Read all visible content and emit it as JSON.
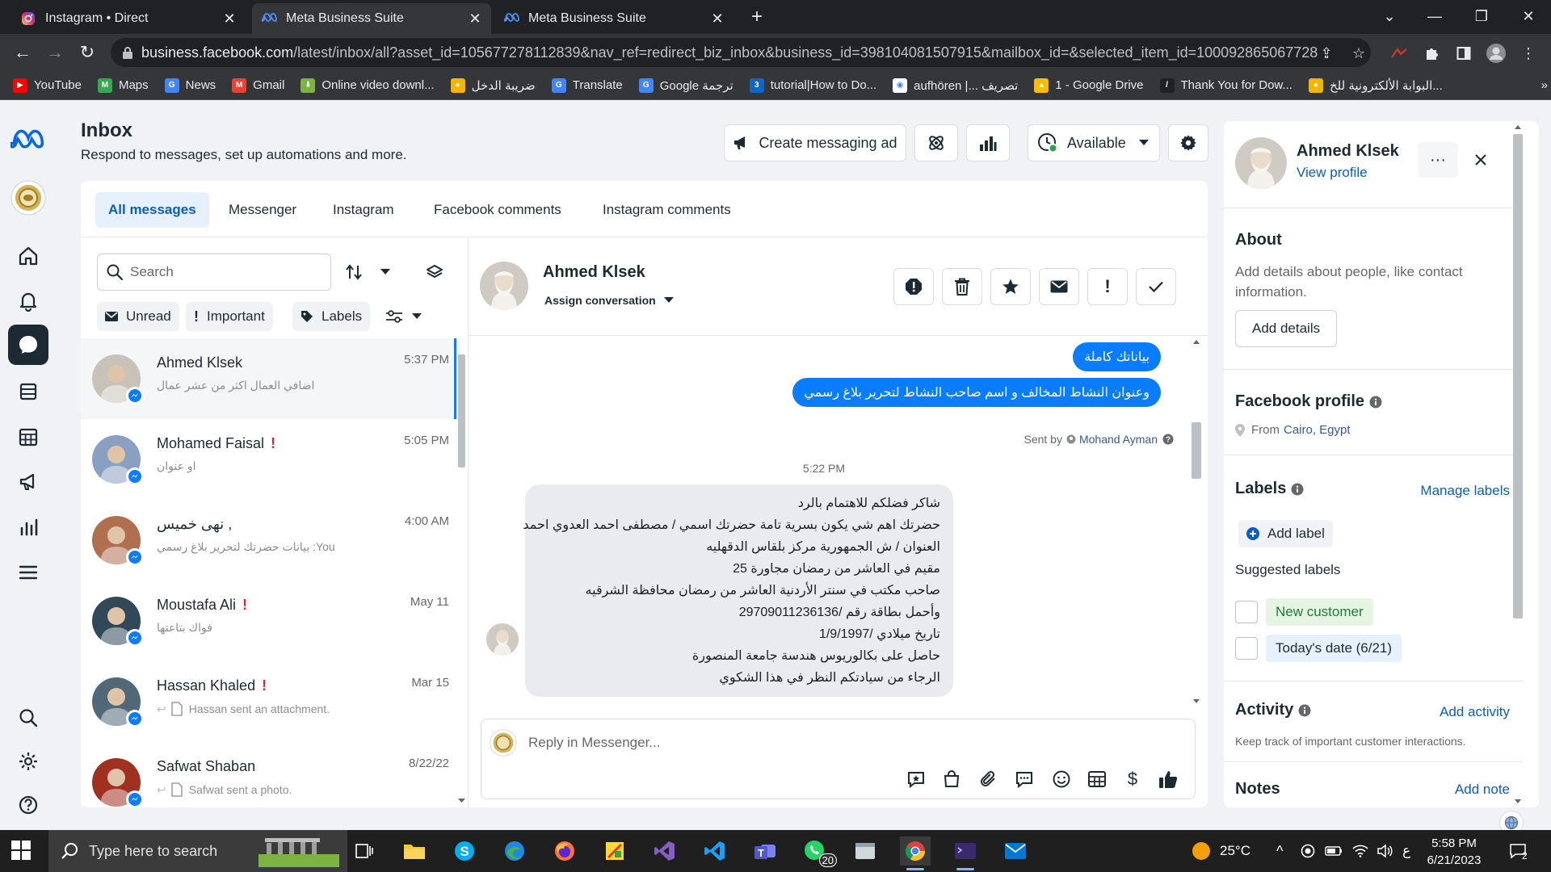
{
  "browser": {
    "tabs": [
      {
        "title": "Instagram • Direct",
        "icon": "instagram-icon",
        "active": false
      },
      {
        "title": "Meta Business Suite",
        "icon": "meta-icon",
        "active": true
      },
      {
        "title": "Meta Business Suite",
        "icon": "meta-icon",
        "active": false
      }
    ],
    "url_host": "business.facebook.com",
    "url_path": "/latest/inbox/all?asset_id=105677278112839&nav_ref=redirect_biz_inbox&business_id=398104081507915&mailbox_id=&selected_item_id=100092865067728",
    "bookmarks": [
      {
        "label": "YouTube",
        "color": "#ff0000",
        "glyph": "▶"
      },
      {
        "label": "Maps",
        "color": "#34a853",
        "glyph": "M"
      },
      {
        "label": "News",
        "color": "#4285f4",
        "glyph": "G"
      },
      {
        "label": "Gmail",
        "color": "#ea4335",
        "glyph": "M"
      },
      {
        "label": "Online video downl...",
        "color": "#7cb342",
        "glyph": "⬇"
      },
      {
        "label": "ضريبة الدخل",
        "color": "#f4b400",
        "glyph": "●"
      },
      {
        "label": "Translate",
        "color": "#4285f4",
        "glyph": "G"
      },
      {
        "label": "Google ترجمة",
        "color": "#4285f4",
        "glyph": "G"
      },
      {
        "label": "tutorial|How to Do...",
        "color": "#1565c0",
        "glyph": "3"
      },
      {
        "label": "aufhören |... تصريف",
        "color": "#ffffff",
        "glyph": "◉"
      },
      {
        "label": "1 - Google Drive",
        "color": "#fbbc04",
        "glyph": "▲"
      },
      {
        "label": "Thank You for Dow...",
        "color": "#202124",
        "glyph": "/"
      },
      {
        "label": "البوابة الألكترونية للخ...",
        "color": "#f4b400",
        "glyph": "●"
      }
    ]
  },
  "inbox": {
    "title": "Inbox",
    "subtitle": "Respond to messages, set up automations and more.",
    "create_ad": "Create messaging ad",
    "availability": "Available",
    "tabs": [
      "All messages",
      "Messenger",
      "Instagram",
      "Facebook comments",
      "Instagram comments"
    ],
    "search_placeholder": "Search",
    "filters": [
      "Unread",
      "Important",
      "Labels"
    ]
  },
  "conversations": [
    {
      "name": "Ahmed Klsek",
      "time": "5:37 PM",
      "preview": "اضافي العمال اكثر من عشر عمال",
      "important": false,
      "selected": true,
      "attachment": false,
      "avatar_color": "#c8c2b8"
    },
    {
      "name": "Mohamed Faisal",
      "time": "5:05 PM",
      "preview": "او عنوان",
      "important": true,
      "selected": false,
      "attachment": false,
      "avatar_color": "#8aa0c0"
    },
    {
      "name": "نهى خميس ,",
      "time": "4:00 AM",
      "preview": "You: بيانات حضرتك لتحرير بلاغ رسمي",
      "important": false,
      "selected": false,
      "attachment": false,
      "avatar_color": "#b07050"
    },
    {
      "name": "Moustafa Ali",
      "time": "May 11",
      "preview": "فواك بتاعتها",
      "important": true,
      "selected": false,
      "attachment": false,
      "avatar_color": "#304858"
    },
    {
      "name": "Hassan Khaled",
      "time": "Mar 15",
      "preview": "Hassan sent an attachment.",
      "important": true,
      "selected": false,
      "attachment": true,
      "avatar_color": "#506878"
    },
    {
      "name": "Safwat Shaban",
      "time": "8/22/22",
      "preview": "Safwat sent a photo.",
      "important": false,
      "selected": false,
      "attachment": true,
      "avatar_color": "#a03020"
    }
  ],
  "chat": {
    "name": "Ahmed Klsek",
    "assign": "Assign conversation",
    "outgoing": [
      "بياناتك كاملة",
      "وعنوان النشاط المخالف و اسم صاحب النشاط لتحرير  بلاغ رسمي"
    ],
    "sent_by_label": "Sent by",
    "sent_by_agent": "Mohand Ayman",
    "timestamp": "5:22 PM",
    "incoming_lines": [
      "شاكر فضلكم للاهتمام بالرد",
      "حضرتك اهم شي يكون بسرية تامة حضرتك اسمي / مصطفى احمد العدوي احمد",
      "العنوان / ش الجمهورية مركز بلقاس الدقهليه",
      "مقيم في العاشر من رمضان مجاورة 25",
      "صاحب مكتب في سنتر الأردنية العاشر من رمضان محافظة الشرقيه",
      "وأحمل بطاقة رقم /29709011236136",
      "تاريخ ميلادي /1/9/1997",
      "حاصل على بكالوريوس هندسة جامعة المنصورة",
      "الرجاء من سيادتكم النظر في هذا الشكوي"
    ],
    "reply_placeholder": "Reply in Messenger..."
  },
  "profile": {
    "name": "Ahmed Klsek",
    "view_profile": "View profile",
    "about_title": "About",
    "about_text": "Add details about people, like contact information.",
    "add_details": "Add details",
    "fb_profile_title": "Facebook profile",
    "from_label": "From",
    "from_value": "Cairo, Egypt",
    "labels_title": "Labels",
    "manage_labels": "Manage labels",
    "add_label": "Add label",
    "suggested_title": "Suggested labels",
    "suggested": [
      "New customer",
      "Today's date (6/21)"
    ],
    "activity_title": "Activity",
    "add_activity": "Add activity",
    "activity_text": "Keep track of important customer interactions.",
    "notes_title": "Notes",
    "add_note": "Add note"
  },
  "taskbar": {
    "search_placeholder": "Type here to search",
    "weather": "25°C",
    "whatsapp_badge": "20",
    "lang": "ع",
    "time": "5:58 PM",
    "date": "6/21/2023",
    "notif_count": "2"
  }
}
